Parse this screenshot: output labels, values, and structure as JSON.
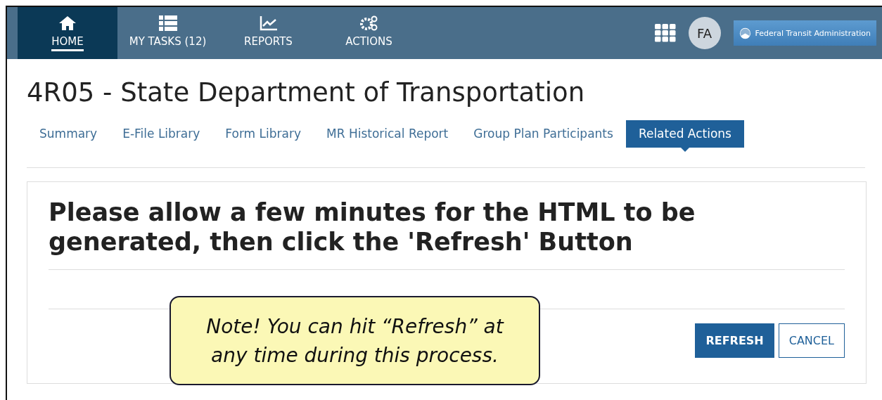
{
  "nav": {
    "items": [
      {
        "label": "HOME",
        "selected": true
      },
      {
        "label": "MY TASKS (12)",
        "selected": false
      },
      {
        "label": "REPORTS",
        "selected": false
      },
      {
        "label": "ACTIONS",
        "selected": false
      }
    ],
    "avatar": "FA",
    "agency": "Federal Transit Administration"
  },
  "title": "4R05 - State Department of Transportation",
  "tabs": [
    {
      "label": "Summary",
      "selected": false
    },
    {
      "label": "E-File Library",
      "selected": false
    },
    {
      "label": "Form Library",
      "selected": false
    },
    {
      "label": "MR Historical Report",
      "selected": false
    },
    {
      "label": "Group Plan Participants",
      "selected": false
    },
    {
      "label": "Related Actions",
      "selected": true
    }
  ],
  "panel": {
    "message": "Please allow a few minutes for the HTML to be generated, then click the 'Refresh' Button",
    "buttons": [
      {
        "label": "REFRESH",
        "kind": "primary"
      },
      {
        "label": "CANCEL",
        "kind": "secondary"
      }
    ]
  },
  "callout": "Note! You can hit “Refresh” at any time during this process."
}
